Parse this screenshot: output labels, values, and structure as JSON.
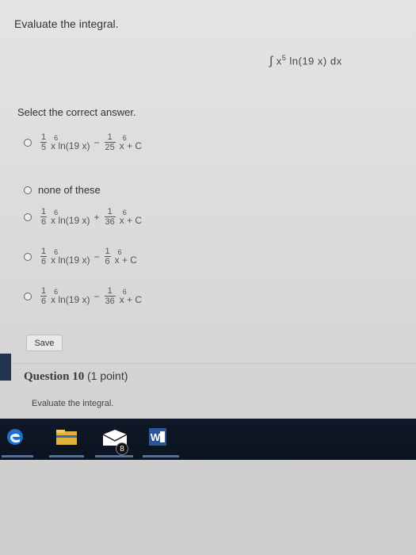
{
  "question": {
    "prompt": "Evaluate the integral.",
    "integral": {
      "symbol": "∫",
      "base": "x",
      "power": "5",
      "func": "ln(19 x)",
      "dx": "dx"
    }
  },
  "select_text": "Select the correct answer.",
  "options": [
    {
      "id": "a",
      "coef1_num": "1",
      "coef1_den": "5",
      "pow1": "6",
      "term": "x ln(19 x)",
      "sign": "−",
      "coef2_num": "1",
      "coef2_den": "25",
      "pow2": "6",
      "tail": "x + C"
    },
    {
      "id": "b",
      "label": "none of these"
    },
    {
      "id": "c",
      "coef1_num": "1",
      "coef1_den": "6",
      "pow1": "6",
      "term": "x ln(19 x)",
      "sign": "+",
      "coef2_num": "1",
      "coef2_den": "36",
      "pow2": "6",
      "tail": "x + C"
    },
    {
      "id": "d",
      "coef1_num": "1",
      "coef1_den": "6",
      "pow1": "6",
      "term": "x ln(19 x)",
      "sign": "−",
      "coef2_num": "1",
      "coef2_den": "6",
      "pow2": "6",
      "tail": "x + C"
    },
    {
      "id": "e",
      "coef1_num": "1",
      "coef1_den": "6",
      "pow1": "6",
      "term": "x ln(19 x)",
      "sign": "−",
      "coef2_num": "1",
      "coef2_den": "36",
      "pow2": "6",
      "tail": "x + C"
    }
  ],
  "save_label": "Save",
  "next_question": {
    "title": "Question 10",
    "points": "(1 point)",
    "prompt": "Evaluate the integral."
  },
  "taskbar": {
    "icons": [
      "edge-icon",
      "file-explorer-icon",
      "mail-icon",
      "word-icon"
    ],
    "mail_badge": "8",
    "word_letter": "W"
  }
}
